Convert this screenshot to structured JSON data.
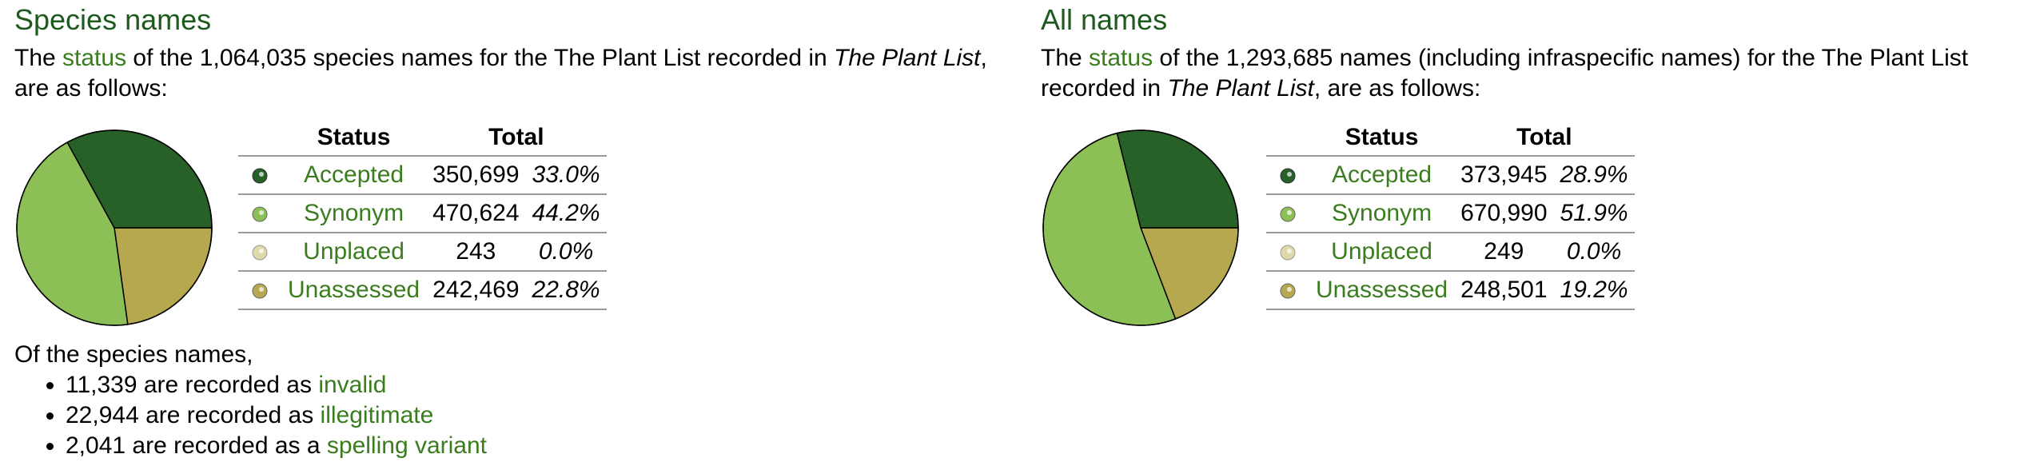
{
  "left": {
    "heading": "Species names",
    "intro": {
      "pre": "The ",
      "link": "status",
      "mid": " of the 1,064,035 species names for the The Plant List recorded in ",
      "italic": "The Plant List",
      "post": ", are as follows:"
    },
    "table": {
      "headers": [
        "Status",
        "Total"
      ],
      "rows": [
        {
          "label": "Accepted",
          "total": "350,699",
          "pct": "33.0%"
        },
        {
          "label": "Synonym",
          "total": "470,624",
          "pct": "44.2%"
        },
        {
          "label": "Unplaced",
          "total": "243",
          "pct": "0.0%"
        },
        {
          "label": "Unassessed",
          "total": "242,469",
          "pct": "22.8%"
        }
      ]
    },
    "notes": {
      "lead": "Of the species names,",
      "items": [
        {
          "pre": "11,339 are recorded as ",
          "link": "invalid"
        },
        {
          "pre": "22,944 are recorded as ",
          "link": "illegitimate"
        },
        {
          "pre": "2,041 are recorded as a ",
          "link": "spelling variant"
        }
      ]
    }
  },
  "right": {
    "heading": "All names",
    "intro": {
      "pre": "The ",
      "link": "status",
      "mid": " of the 1,293,685 names (including infraspecific names) for the The Plant List recorded in ",
      "italic": "The Plant List",
      "post": ", are as follows:"
    },
    "table": {
      "headers": [
        "Status",
        "Total"
      ],
      "rows": [
        {
          "label": "Accepted",
          "total": "373,945",
          "pct": "28.9%"
        },
        {
          "label": "Synonym",
          "total": "670,990",
          "pct": "51.9%"
        },
        {
          "label": "Unplaced",
          "total": "249",
          "pct": "0.0%"
        },
        {
          "label": "Unassessed",
          "total": "248,501",
          "pct": "19.2%"
        }
      ]
    }
  },
  "colors": {
    "accepted": "#276128",
    "synonym": "#8cbf55",
    "unplaced": "#ddd9a8",
    "unassessed": "#b5a84e",
    "link": "#3a7d1e",
    "heading": "#1e5a1e"
  },
  "chart_data": [
    {
      "type": "pie",
      "categories": [
        "Accepted",
        "Synonym",
        "Unplaced",
        "Unassessed"
      ],
      "values": [
        33.0,
        44.2,
        0.0,
        22.8
      ]
    },
    {
      "type": "pie",
      "categories": [
        "Accepted",
        "Synonym",
        "Unplaced",
        "Unassessed"
      ],
      "values": [
        28.9,
        51.9,
        0.0,
        19.2
      ]
    }
  ]
}
